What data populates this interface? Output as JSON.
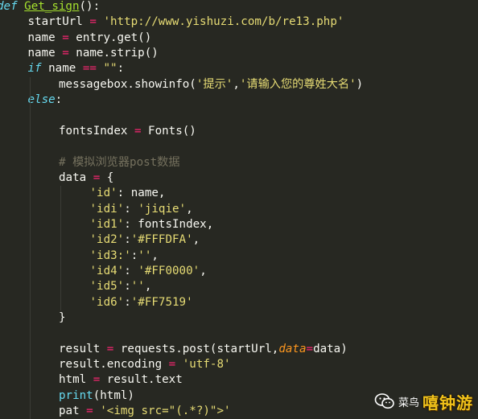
{
  "code_lines": [
    {
      "indent": 0,
      "tokens": [
        {
          "t": "def",
          "c": "kw"
        },
        {
          "t": " ",
          "c": "var"
        },
        {
          "t": "Get_sign",
          "c": "fn"
        },
        {
          "t": "():",
          "c": "var"
        }
      ]
    },
    {
      "indent": 1,
      "tokens": [
        {
          "t": "startUrl",
          "c": "var"
        },
        {
          "t": " = ",
          "c": "op"
        },
        {
          "t": "'http://www.yishuzi.com/b/re13.php'",
          "c": "str"
        }
      ]
    },
    {
      "indent": 1,
      "tokens": [
        {
          "t": "name",
          "c": "var"
        },
        {
          "t": " = ",
          "c": "op"
        },
        {
          "t": "entry.get()",
          "c": "var"
        }
      ]
    },
    {
      "indent": 1,
      "tokens": [
        {
          "t": "name",
          "c": "var"
        },
        {
          "t": " = ",
          "c": "op"
        },
        {
          "t": "name.strip()",
          "c": "var"
        }
      ]
    },
    {
      "indent": 1,
      "tokens": [
        {
          "t": "if",
          "c": "kw"
        },
        {
          "t": " name ",
          "c": "var"
        },
        {
          "t": "==",
          "c": "op"
        },
        {
          "t": " ",
          "c": "var"
        },
        {
          "t": "\"\"",
          "c": "str"
        },
        {
          "t": ":",
          "c": "var"
        }
      ]
    },
    {
      "indent": 2,
      "tokens": [
        {
          "t": "messagebox.showinfo(",
          "c": "var"
        },
        {
          "t": "'提示'",
          "c": "str"
        },
        {
          "t": ",",
          "c": "var"
        },
        {
          "t": "'请输入您的尊姓大名'",
          "c": "str"
        },
        {
          "t": ")",
          "c": "var"
        }
      ]
    },
    {
      "indent": 1,
      "tokens": [
        {
          "t": "else",
          "c": "kw"
        },
        {
          "t": ":",
          "c": "var"
        }
      ]
    },
    {
      "indent": 0,
      "tokens": []
    },
    {
      "indent": 2,
      "tokens": [
        {
          "t": "fontsIndex",
          "c": "var"
        },
        {
          "t": " = ",
          "c": "op"
        },
        {
          "t": "Fonts()",
          "c": "var"
        }
      ]
    },
    {
      "indent": 0,
      "tokens": []
    },
    {
      "indent": 2,
      "tokens": [
        {
          "t": "# 模拟浏览器post数据",
          "c": "cm"
        }
      ]
    },
    {
      "indent": 2,
      "tokens": [
        {
          "t": "data",
          "c": "var"
        },
        {
          "t": " = ",
          "c": "op"
        },
        {
          "t": "{",
          "c": "var"
        }
      ]
    },
    {
      "indent": 3,
      "tokens": [
        {
          "t": "'id'",
          "c": "str"
        },
        {
          "t": ": name,",
          "c": "var"
        }
      ]
    },
    {
      "indent": 3,
      "tokens": [
        {
          "t": "'idi'",
          "c": "str"
        },
        {
          "t": ": ",
          "c": "var"
        },
        {
          "t": "'jiqie'",
          "c": "str"
        },
        {
          "t": ",",
          "c": "var"
        }
      ]
    },
    {
      "indent": 3,
      "tokens": [
        {
          "t": "'id1'",
          "c": "str"
        },
        {
          "t": ": fontsIndex,",
          "c": "var"
        }
      ]
    },
    {
      "indent": 3,
      "tokens": [
        {
          "t": "'id2'",
          "c": "str"
        },
        {
          "t": ":",
          "c": "var"
        },
        {
          "t": "'#FFFDFA'",
          "c": "str"
        },
        {
          "t": ",",
          "c": "var"
        }
      ]
    },
    {
      "indent": 3,
      "tokens": [
        {
          "t": "'id3:'",
          "c": "str"
        },
        {
          "t": ":",
          "c": "var"
        },
        {
          "t": "''",
          "c": "str"
        },
        {
          "t": ",",
          "c": "var"
        }
      ]
    },
    {
      "indent": 3,
      "tokens": [
        {
          "t": "'id4'",
          "c": "str"
        },
        {
          "t": ": ",
          "c": "var"
        },
        {
          "t": "'#FF0000'",
          "c": "str"
        },
        {
          "t": ",",
          "c": "var"
        }
      ]
    },
    {
      "indent": 3,
      "tokens": [
        {
          "t": "'id5'",
          "c": "str"
        },
        {
          "t": ":",
          "c": "var"
        },
        {
          "t": "''",
          "c": "str"
        },
        {
          "t": ",",
          "c": "var"
        }
      ]
    },
    {
      "indent": 3,
      "tokens": [
        {
          "t": "'id6'",
          "c": "str"
        },
        {
          "t": ":",
          "c": "var"
        },
        {
          "t": "'#FF7519'",
          "c": "str"
        }
      ]
    },
    {
      "indent": 2,
      "tokens": [
        {
          "t": "}",
          "c": "var"
        }
      ]
    },
    {
      "indent": 0,
      "tokens": []
    },
    {
      "indent": 2,
      "tokens": [
        {
          "t": "result",
          "c": "var"
        },
        {
          "t": " = ",
          "c": "op"
        },
        {
          "t": "requests.post(startUrl,",
          "c": "var"
        },
        {
          "t": "data",
          "c": "param"
        },
        {
          "t": "=",
          "c": "op"
        },
        {
          "t": "data)",
          "c": "var"
        }
      ]
    },
    {
      "indent": 2,
      "tokens": [
        {
          "t": "result.encoding",
          "c": "var"
        },
        {
          "t": " = ",
          "c": "op"
        },
        {
          "t": "'utf-8'",
          "c": "str"
        }
      ]
    },
    {
      "indent": 2,
      "tokens": [
        {
          "t": "html",
          "c": "var"
        },
        {
          "t": " = ",
          "c": "op"
        },
        {
          "t": "result.text",
          "c": "var"
        }
      ]
    },
    {
      "indent": 2,
      "tokens": [
        {
          "t": "print",
          "c": "builtin"
        },
        {
          "t": "(html)",
          "c": "var"
        }
      ]
    },
    {
      "indent": 2,
      "tokens": [
        {
          "t": "pat",
          "c": "var"
        },
        {
          "t": " = ",
          "c": "op"
        },
        {
          "t": "'<img src=\"(.*?)\">'",
          "c": "str"
        }
      ]
    }
  ],
  "watermark": {
    "icon": "wechat-icon",
    "text": "菜鸟",
    "brand": "嘻钟游"
  },
  "colors": {
    "background": "#272822",
    "keyword": "#66d9ef",
    "function": "#a6e22e",
    "operator": "#f92672",
    "string": "#e6db74",
    "comment": "#75715e",
    "text": "#f8f8f2",
    "brand": "#f1c21a"
  }
}
